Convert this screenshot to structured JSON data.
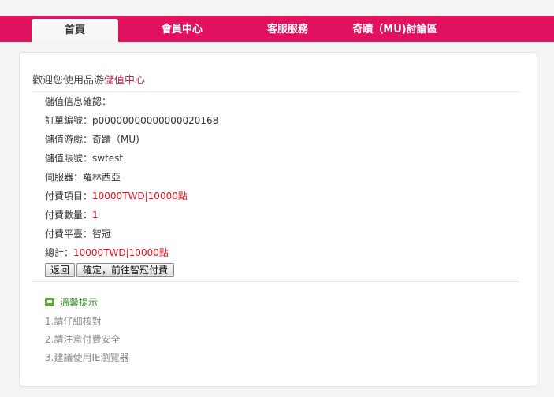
{
  "nav": {
    "tabs": [
      {
        "label": "首頁",
        "active": true
      },
      {
        "label": "會員中心",
        "active": false
      },
      {
        "label": "客服服務",
        "active": false
      },
      {
        "label": "奇蹟（MU)討論區",
        "active": false
      }
    ]
  },
  "welcome": {
    "prefix": "歡迎您使用品游",
    "highlight": "儲值中心"
  },
  "details": {
    "confirm_heading": "儲值信息確認：",
    "order_no_label": "訂單編號：",
    "order_no": "p00000000000000020168",
    "game_label": "儲值游戲：",
    "game": "奇蹟（MU)",
    "account_label": "儲值賬號：",
    "account": "swtest",
    "server_label": "伺服器：",
    "server": "羅林西亞",
    "item_label": "付費項目：",
    "item": "10000TWD|10000點",
    "qty_label": "付費數量：",
    "qty": "1",
    "platform_label": "付費平臺：",
    "platform": "智冠",
    "total_label": "總計：",
    "total": "10000TWD|10000點"
  },
  "buttons": {
    "back": "返回",
    "confirm": "確定，前往智冠付費"
  },
  "tips": {
    "title": "溫馨提示",
    "items": [
      "1.請仔細核對",
      "2.請注意付費安全",
      "3.建議使用IE瀏覽器"
    ]
  },
  "colors": {
    "nav_bg": "#e0115f",
    "accent_text": "#c0325a",
    "value_red": "#e0111f",
    "tips_green": "#3a8a2a"
  }
}
